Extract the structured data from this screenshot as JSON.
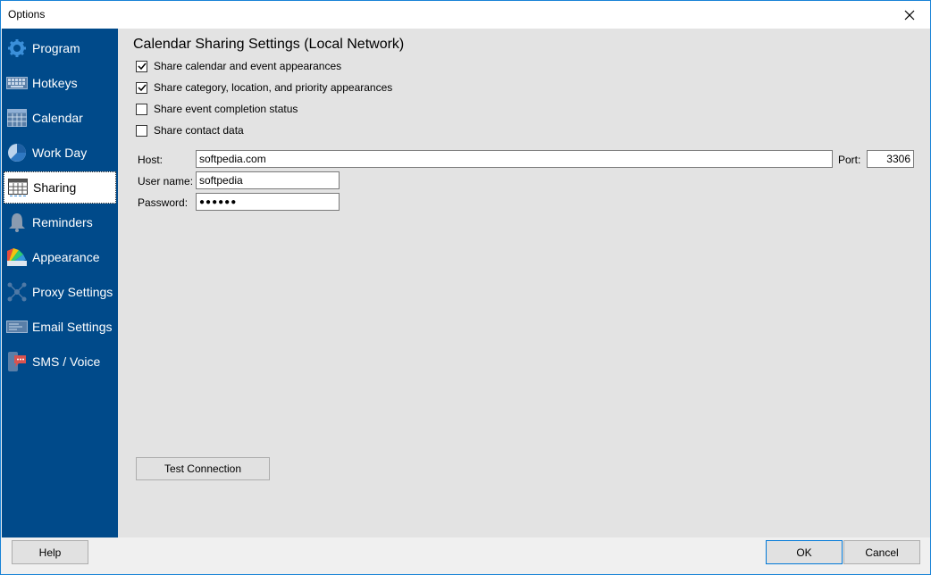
{
  "window": {
    "title": "Options"
  },
  "sidebar": {
    "items": [
      {
        "label": "Program",
        "icon": "gear-icon"
      },
      {
        "label": "Hotkeys",
        "icon": "keyboard-icon"
      },
      {
        "label": "Calendar",
        "icon": "calendar-icon"
      },
      {
        "label": "Work Day",
        "icon": "clock-icon"
      },
      {
        "label": "Sharing",
        "icon": "sharing-icon",
        "active": true
      },
      {
        "label": "Reminders",
        "icon": "bell-icon"
      },
      {
        "label": "Appearance",
        "icon": "palette-icon"
      },
      {
        "label": "Proxy Settings",
        "icon": "network-icon"
      },
      {
        "label": "Email Settings",
        "icon": "email-icon"
      },
      {
        "label": "SMS / Voice",
        "icon": "sms-icon"
      }
    ]
  },
  "main": {
    "heading": "Calendar Sharing Settings (Local Network)",
    "options": [
      {
        "label": "Share calendar and event appearances",
        "checked": true
      },
      {
        "label": "Share category, location, and priority appearances",
        "checked": true
      },
      {
        "label": "Share event completion status",
        "checked": false
      },
      {
        "label": "Share contact data",
        "checked": false
      }
    ],
    "host_label": "Host:",
    "host_value": "softpedia.com",
    "port_label": "Port:",
    "port_value": "3306",
    "username_label": "User name:",
    "username_value": "softpedia",
    "password_label": "Password:",
    "password_value": "●●●●●●",
    "test_button": "Test Connection"
  },
  "footer": {
    "help": "Help",
    "ok": "OK",
    "cancel": "Cancel"
  },
  "colors": {
    "sidebar": "#004a8a",
    "content": "#e3e3e3",
    "window_border": "#1883d7"
  }
}
